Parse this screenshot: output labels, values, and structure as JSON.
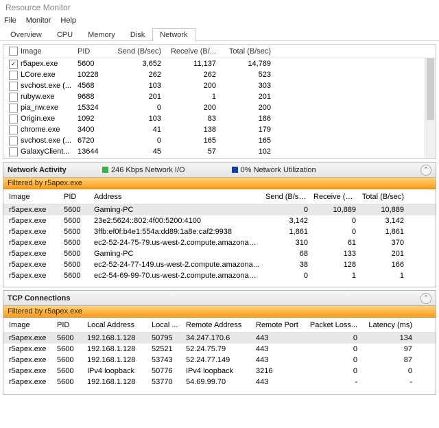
{
  "window_title": "Resource Monitor",
  "menu": {
    "file": "File",
    "monitor": "Monitor",
    "help": "Help"
  },
  "tabs": {
    "overview": "Overview",
    "cpu": "CPU",
    "memory": "Memory",
    "disk": "Disk",
    "network": "Network"
  },
  "top_grid": {
    "cols": {
      "image": "Image",
      "pid": "PID",
      "send": "Send (B/sec)",
      "recv": "Receive (B/...",
      "total": "Total (B/sec)"
    },
    "rows": [
      {
        "checked": true,
        "image": "r5apex.exe",
        "pid": "5600",
        "send": "3,652",
        "recv": "11,137",
        "total": "14,789"
      },
      {
        "checked": false,
        "image": "LCore.exe",
        "pid": "10228",
        "send": "262",
        "recv": "262",
        "total": "523"
      },
      {
        "checked": false,
        "image": "svchost.exe (...",
        "pid": "4568",
        "send": "103",
        "recv": "200",
        "total": "303"
      },
      {
        "checked": false,
        "image": "rubyw.exe",
        "pid": "9688",
        "send": "201",
        "recv": "1",
        "total": "201"
      },
      {
        "checked": false,
        "image": "pia_nw.exe",
        "pid": "15324",
        "send": "0",
        "recv": "200",
        "total": "200"
      },
      {
        "checked": false,
        "image": "Origin.exe",
        "pid": "1092",
        "send": "103",
        "recv": "83",
        "total": "186"
      },
      {
        "checked": false,
        "image": "chrome.exe",
        "pid": "3400",
        "send": "41",
        "recv": "138",
        "total": "179"
      },
      {
        "checked": false,
        "image": "svchost.exe (...",
        "pid": "6720",
        "send": "0",
        "recv": "165",
        "total": "165"
      },
      {
        "checked": false,
        "image": "GalaxyClient...",
        "pid": "13644",
        "send": "45",
        "recv": "57",
        "total": "102"
      }
    ]
  },
  "net_activity": {
    "title": "Network Activity",
    "stat1": "246 Kbps Network I/O",
    "stat2": "0% Network Utilization",
    "filter": "Filtered by r5apex.exe",
    "cols": {
      "image": "Image",
      "pid": "PID",
      "addr": "Address",
      "send": "Send (B/sec)",
      "recv": "Receive (B/...",
      "total": "Total (B/sec)"
    },
    "rows": [
      {
        "sel": true,
        "image": "r5apex.exe",
        "pid": "5600",
        "addr": "Gaming-PC",
        "send": "0",
        "recv": "10,889",
        "total": "10,889"
      },
      {
        "sel": false,
        "image": "r5apex.exe",
        "pid": "5600",
        "addr": "23e2:5624::802:4f00:5200:4100",
        "send": "3,142",
        "recv": "0",
        "total": "3,142"
      },
      {
        "sel": false,
        "image": "r5apex.exe",
        "pid": "5600",
        "addr": "3ffb:ef0f:b4e1:554a:dd89:1a8e:caf2:9938",
        "send": "1,861",
        "recv": "0",
        "total": "1,861"
      },
      {
        "sel": false,
        "image": "r5apex.exe",
        "pid": "5600",
        "addr": "ec2-52-24-75-79.us-west-2.compute.amazonaws...",
        "send": "310",
        "recv": "61",
        "total": "370"
      },
      {
        "sel": false,
        "image": "r5apex.exe",
        "pid": "5600",
        "addr": "Gaming-PC",
        "send": "68",
        "recv": "133",
        "total": "201"
      },
      {
        "sel": false,
        "image": "r5apex.exe",
        "pid": "5600",
        "addr": "ec2-52-24-77-149.us-west-2.compute.amazona...",
        "send": "38",
        "recv": "128",
        "total": "166"
      },
      {
        "sel": false,
        "image": "r5apex.exe",
        "pid": "5600",
        "addr": "ec2-54-69-99-70.us-west-2.compute.amazonaws...",
        "send": "0",
        "recv": "1",
        "total": "1"
      }
    ]
  },
  "tcp": {
    "title": "TCP Connections",
    "filter": "Filtered by r5apex.exe",
    "cols": {
      "image": "Image",
      "pid": "PID",
      "laddr": "Local Address",
      "lport": "Local ...",
      "raddr": "Remote Address",
      "rport": "Remote Port",
      "loss": "Packet Loss...",
      "lat": "Latency (ms)"
    },
    "rows": [
      {
        "sel": true,
        "image": "r5apex.exe",
        "pid": "5600",
        "laddr": "192.168.1.128",
        "lport": "50795",
        "raddr": "34.247.170.6",
        "rport": "443",
        "loss": "0",
        "lat": "134"
      },
      {
        "sel": false,
        "image": "r5apex.exe",
        "pid": "5600",
        "laddr": "192.168.1.128",
        "lport": "52521",
        "raddr": "52.24.75.79",
        "rport": "443",
        "loss": "0",
        "lat": "97"
      },
      {
        "sel": false,
        "image": "r5apex.exe",
        "pid": "5600",
        "laddr": "192.168.1.128",
        "lport": "53743",
        "raddr": "52.24.77.149",
        "rport": "443",
        "loss": "0",
        "lat": "87"
      },
      {
        "sel": false,
        "image": "r5apex.exe",
        "pid": "5600",
        "laddr": "IPv4 loopback",
        "lport": "50776",
        "raddr": "IPv4 loopback",
        "rport": "3216",
        "loss": "0",
        "lat": "0"
      },
      {
        "sel": false,
        "image": "r5apex.exe",
        "pid": "5600",
        "laddr": "192.168.1.128",
        "lport": "53770",
        "raddr": "54.69.99.70",
        "rport": "443",
        "loss": "-",
        "lat": "-"
      }
    ]
  }
}
